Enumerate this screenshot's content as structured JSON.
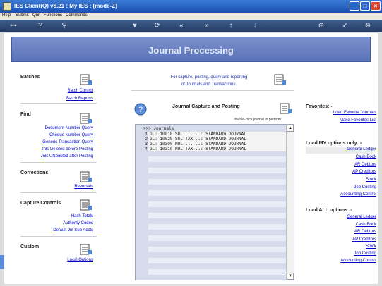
{
  "window": {
    "title": "IES Client(Q) v8.21 : My IES :       [mode-Z]"
  },
  "menu": [
    "Help",
    "Submit",
    "Quit",
    "Functions",
    "Commands"
  ],
  "banner": {
    "title": "Journal Processing"
  },
  "left": {
    "batches": {
      "title": "Batches",
      "links": [
        "Batch Control",
        "Batch Reports"
      ]
    },
    "find": {
      "title": "Find",
      "links": [
        "Document Number Query",
        "Cheque Number Query",
        "Generic Transaction Query",
        "Jnls Deleted before Posting",
        "Jnls UNposted after Posting"
      ]
    },
    "corrections": {
      "title": "Corrections",
      "links": [
        "Reversals"
      ]
    },
    "control": {
      "title": "Capture Controls",
      "links": [
        "Hash Totals",
        "Authority Codes",
        "Default Jnl Sub Accts"
      ]
    },
    "custom": {
      "title": "Custom",
      "links": [
        "Local Options"
      ]
    }
  },
  "center": {
    "intro": [
      "For capture, posting, query and reporting",
      "of Journals and Transactions."
    ],
    "capture_title": "Journal Capture and Posting",
    "hint": "double-click journal to perform",
    "grid_header": ">>> Journals",
    "rows": [
      {
        "n": "1",
        "text": "GL: 10010 SGL ... ..: STANDARD JOURNAL"
      },
      {
        "n": "2",
        "text": "GL: 10020 SGL TAX ..: STANDARD JOURNAL"
      },
      {
        "n": "3",
        "text": "GL: 10300 MUL ... ..: STANDARD JOURNAL"
      },
      {
        "n": "4",
        "text": "GL: 10310 MUL TAX ..: STANDARD JOURNAL"
      }
    ]
  },
  "right": {
    "favorites": {
      "title": "Favorites: -",
      "links": [
        "Load Favorite Journals",
        "Make Favorites List"
      ]
    },
    "my": {
      "title": "Load MY options only: -",
      "links": [
        "General Ledger",
        "Cash Book",
        "AR Debtors",
        "AP Creditors",
        "Stock",
        "Job Costing",
        "Accounting Control"
      ]
    },
    "all": {
      "title": "Load ALL options: -",
      "links": [
        "General Ledger",
        "Cash Book",
        "AR Debtors",
        "AP Creditors",
        "Stock",
        "Job Costing",
        "Accounting Control"
      ]
    }
  },
  "colors": {
    "banner": "#5a72b8",
    "link": "#0000cc",
    "titlebar": "#1c4fb0"
  }
}
